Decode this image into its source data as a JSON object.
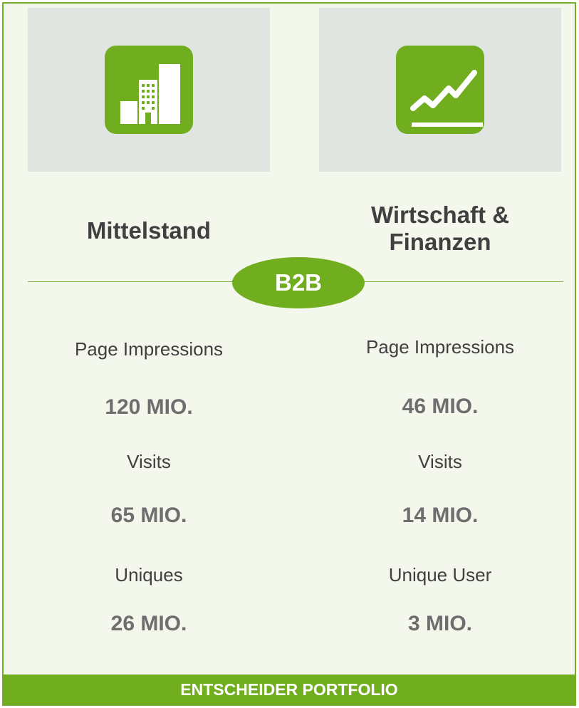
{
  "colors": {
    "accent_green": "#71ae1f",
    "border_green": "#71ac2c",
    "card_background": "#f3f7ec",
    "tile_background": "#e0e5e1",
    "text_dark": "#404040",
    "text_value": "#6e6e6e"
  },
  "badge": {
    "label": "B2B"
  },
  "columns": [
    {
      "icon": "building-bar-chart-icon",
      "title_lines": [
        "Mittelstand"
      ],
      "metrics": [
        {
          "label": "Page Impressions",
          "value": "120 MIO."
        },
        {
          "label": "Visits",
          "value": "65 MIO."
        },
        {
          "label": "Uniques",
          "value": "26 MIO."
        }
      ]
    },
    {
      "icon": "trend-line-icon",
      "title_lines": [
        "Wirtschaft &",
        "Finanzen"
      ],
      "metrics": [
        {
          "label": "Page Impressions",
          "value": "46 MIO."
        },
        {
          "label": "Visits",
          "value": "14 MIO."
        },
        {
          "label": "Unique User",
          "value": "3 MIO."
        }
      ]
    }
  ],
  "footer": {
    "label": "ENTSCHEIDER PORTFOLIO"
  }
}
